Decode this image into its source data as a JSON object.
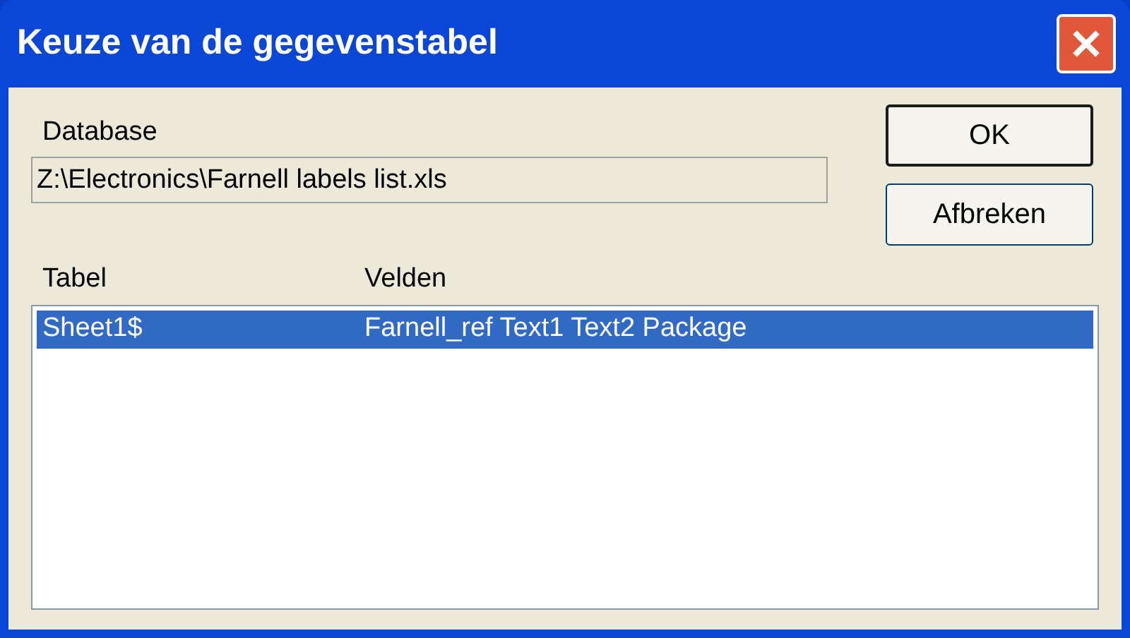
{
  "window": {
    "title": "Keuze van de gegevenstabel"
  },
  "database": {
    "label": "Database",
    "value": "Z:\\Electronics\\Farnell labels list.xls"
  },
  "buttons": [
    {
      "label": "OK",
      "default": true
    },
    {
      "label": "Afbreken",
      "default": false
    }
  ],
  "table": {
    "columns": [
      "Tabel",
      "Velden"
    ],
    "rows": [
      {
        "cells": [
          "Sheet1$",
          "Farnell_ref Text1 Text2 Package"
        ],
        "selected": true
      }
    ]
  }
}
